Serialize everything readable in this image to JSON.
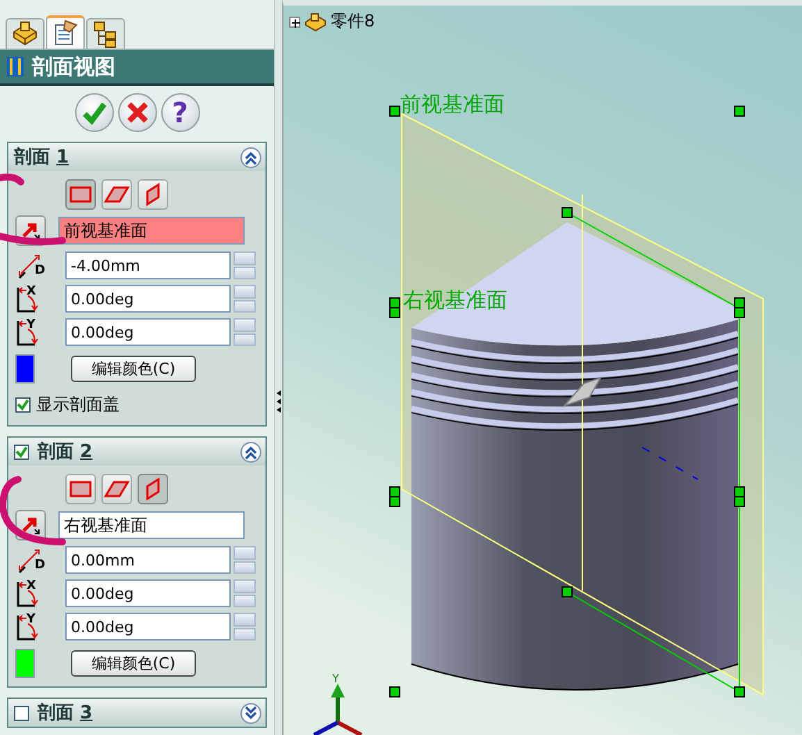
{
  "tabs": [
    {
      "kind": "feature",
      "selected": false
    },
    {
      "kind": "property",
      "selected": true
    },
    {
      "kind": "configuration",
      "selected": false
    }
  ],
  "panel": {
    "title": "剖面视图",
    "actions": [
      {
        "kind": "ok"
      },
      {
        "kind": "cancel"
      },
      {
        "kind": "help",
        "label": "?"
      }
    ]
  },
  "sections": [
    {
      "kind": "fixed",
      "title": "剖面",
      "number": "1",
      "expanded": true,
      "plane_options": [
        {
          "kind": "front",
          "selected": true
        },
        {
          "kind": "top",
          "selected": false
        },
        {
          "kind": "right",
          "selected": false
        }
      ],
      "reference": {
        "value": "前视基准面",
        "highlighted": true
      },
      "fields": [
        {
          "kind": "offset",
          "symbol": "D",
          "value": "-4.00mm"
        },
        {
          "kind": "rotate",
          "symbol": "X",
          "value": "0.00deg"
        },
        {
          "kind": "rotate",
          "symbol": "Y",
          "value": "0.00deg"
        }
      ],
      "color": "#0000ff",
      "color_button": "编辑颜色(C)",
      "show_cap": {
        "label": "显示剖面盖",
        "checked": true
      }
    },
    {
      "kind": "optional",
      "checked": true,
      "title": "剖面",
      "number": "2",
      "expanded": true,
      "plane_options": [
        {
          "kind": "front",
          "selected": false
        },
        {
          "kind": "top",
          "selected": false
        },
        {
          "kind": "right",
          "selected": true
        }
      ],
      "reference": {
        "value": "右视基准面",
        "highlighted": false
      },
      "fields": [
        {
          "kind": "offset",
          "symbol": "D",
          "value": "0.00mm"
        },
        {
          "kind": "rotate",
          "symbol": "X",
          "value": "0.00deg"
        },
        {
          "kind": "rotate",
          "symbol": "Y",
          "value": "0.00deg"
        }
      ],
      "color": "#00ff00",
      "color_button": "编辑颜色(C)"
    },
    {
      "kind": "optional",
      "checked": false,
      "title": "剖面",
      "number": "3",
      "expanded": false
    }
  ],
  "viewport": {
    "tree": {
      "label": "零件8",
      "expanded": false
    },
    "plane_labels": [
      "前视基准面",
      "右视基准面"
    ],
    "axis_label": "Y"
  }
}
